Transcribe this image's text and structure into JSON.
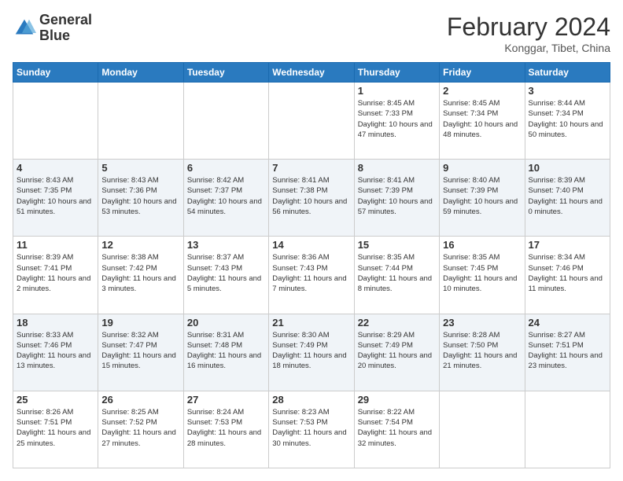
{
  "header": {
    "logo_line1": "General",
    "logo_line2": "Blue",
    "month_title": "February 2024",
    "subtitle": "Konggar, Tibet, China"
  },
  "weekdays": [
    "Sunday",
    "Monday",
    "Tuesday",
    "Wednesday",
    "Thursday",
    "Friday",
    "Saturday"
  ],
  "weeks": [
    [
      {
        "day": "",
        "sunrise": "",
        "sunset": "",
        "daylight": ""
      },
      {
        "day": "",
        "sunrise": "",
        "sunset": "",
        "daylight": ""
      },
      {
        "day": "",
        "sunrise": "",
        "sunset": "",
        "daylight": ""
      },
      {
        "day": "",
        "sunrise": "",
        "sunset": "",
        "daylight": ""
      },
      {
        "day": "1",
        "sunrise": "Sunrise: 8:45 AM",
        "sunset": "Sunset: 7:33 PM",
        "daylight": "Daylight: 10 hours and 47 minutes."
      },
      {
        "day": "2",
        "sunrise": "Sunrise: 8:45 AM",
        "sunset": "Sunset: 7:34 PM",
        "daylight": "Daylight: 10 hours and 48 minutes."
      },
      {
        "day": "3",
        "sunrise": "Sunrise: 8:44 AM",
        "sunset": "Sunset: 7:34 PM",
        "daylight": "Daylight: 10 hours and 50 minutes."
      }
    ],
    [
      {
        "day": "4",
        "sunrise": "Sunrise: 8:43 AM",
        "sunset": "Sunset: 7:35 PM",
        "daylight": "Daylight: 10 hours and 51 minutes."
      },
      {
        "day": "5",
        "sunrise": "Sunrise: 8:43 AM",
        "sunset": "Sunset: 7:36 PM",
        "daylight": "Daylight: 10 hours and 53 minutes."
      },
      {
        "day": "6",
        "sunrise": "Sunrise: 8:42 AM",
        "sunset": "Sunset: 7:37 PM",
        "daylight": "Daylight: 10 hours and 54 minutes."
      },
      {
        "day": "7",
        "sunrise": "Sunrise: 8:41 AM",
        "sunset": "Sunset: 7:38 PM",
        "daylight": "Daylight: 10 hours and 56 minutes."
      },
      {
        "day": "8",
        "sunrise": "Sunrise: 8:41 AM",
        "sunset": "Sunset: 7:39 PM",
        "daylight": "Daylight: 10 hours and 57 minutes."
      },
      {
        "day": "9",
        "sunrise": "Sunrise: 8:40 AM",
        "sunset": "Sunset: 7:39 PM",
        "daylight": "Daylight: 10 hours and 59 minutes."
      },
      {
        "day": "10",
        "sunrise": "Sunrise: 8:39 AM",
        "sunset": "Sunset: 7:40 PM",
        "daylight": "Daylight: 11 hours and 0 minutes."
      }
    ],
    [
      {
        "day": "11",
        "sunrise": "Sunrise: 8:39 AM",
        "sunset": "Sunset: 7:41 PM",
        "daylight": "Daylight: 11 hours and 2 minutes."
      },
      {
        "day": "12",
        "sunrise": "Sunrise: 8:38 AM",
        "sunset": "Sunset: 7:42 PM",
        "daylight": "Daylight: 11 hours and 3 minutes."
      },
      {
        "day": "13",
        "sunrise": "Sunrise: 8:37 AM",
        "sunset": "Sunset: 7:43 PM",
        "daylight": "Daylight: 11 hours and 5 minutes."
      },
      {
        "day": "14",
        "sunrise": "Sunrise: 8:36 AM",
        "sunset": "Sunset: 7:43 PM",
        "daylight": "Daylight: 11 hours and 7 minutes."
      },
      {
        "day": "15",
        "sunrise": "Sunrise: 8:35 AM",
        "sunset": "Sunset: 7:44 PM",
        "daylight": "Daylight: 11 hours and 8 minutes."
      },
      {
        "day": "16",
        "sunrise": "Sunrise: 8:35 AM",
        "sunset": "Sunset: 7:45 PM",
        "daylight": "Daylight: 11 hours and 10 minutes."
      },
      {
        "day": "17",
        "sunrise": "Sunrise: 8:34 AM",
        "sunset": "Sunset: 7:46 PM",
        "daylight": "Daylight: 11 hours and 11 minutes."
      }
    ],
    [
      {
        "day": "18",
        "sunrise": "Sunrise: 8:33 AM",
        "sunset": "Sunset: 7:46 PM",
        "daylight": "Daylight: 11 hours and 13 minutes."
      },
      {
        "day": "19",
        "sunrise": "Sunrise: 8:32 AM",
        "sunset": "Sunset: 7:47 PM",
        "daylight": "Daylight: 11 hours and 15 minutes."
      },
      {
        "day": "20",
        "sunrise": "Sunrise: 8:31 AM",
        "sunset": "Sunset: 7:48 PM",
        "daylight": "Daylight: 11 hours and 16 minutes."
      },
      {
        "day": "21",
        "sunrise": "Sunrise: 8:30 AM",
        "sunset": "Sunset: 7:49 PM",
        "daylight": "Daylight: 11 hours and 18 minutes."
      },
      {
        "day": "22",
        "sunrise": "Sunrise: 8:29 AM",
        "sunset": "Sunset: 7:49 PM",
        "daylight": "Daylight: 11 hours and 20 minutes."
      },
      {
        "day": "23",
        "sunrise": "Sunrise: 8:28 AM",
        "sunset": "Sunset: 7:50 PM",
        "daylight": "Daylight: 11 hours and 21 minutes."
      },
      {
        "day": "24",
        "sunrise": "Sunrise: 8:27 AM",
        "sunset": "Sunset: 7:51 PM",
        "daylight": "Daylight: 11 hours and 23 minutes."
      }
    ],
    [
      {
        "day": "25",
        "sunrise": "Sunrise: 8:26 AM",
        "sunset": "Sunset: 7:51 PM",
        "daylight": "Daylight: 11 hours and 25 minutes."
      },
      {
        "day": "26",
        "sunrise": "Sunrise: 8:25 AM",
        "sunset": "Sunset: 7:52 PM",
        "daylight": "Daylight: 11 hours and 27 minutes."
      },
      {
        "day": "27",
        "sunrise": "Sunrise: 8:24 AM",
        "sunset": "Sunset: 7:53 PM",
        "daylight": "Daylight: 11 hours and 28 minutes."
      },
      {
        "day": "28",
        "sunrise": "Sunrise: 8:23 AM",
        "sunset": "Sunset: 7:53 PM",
        "daylight": "Daylight: 11 hours and 30 minutes."
      },
      {
        "day": "29",
        "sunrise": "Sunrise: 8:22 AM",
        "sunset": "Sunset: 7:54 PM",
        "daylight": "Daylight: 11 hours and 32 minutes."
      },
      {
        "day": "",
        "sunrise": "",
        "sunset": "",
        "daylight": ""
      },
      {
        "day": "",
        "sunrise": "",
        "sunset": "",
        "daylight": ""
      }
    ]
  ]
}
